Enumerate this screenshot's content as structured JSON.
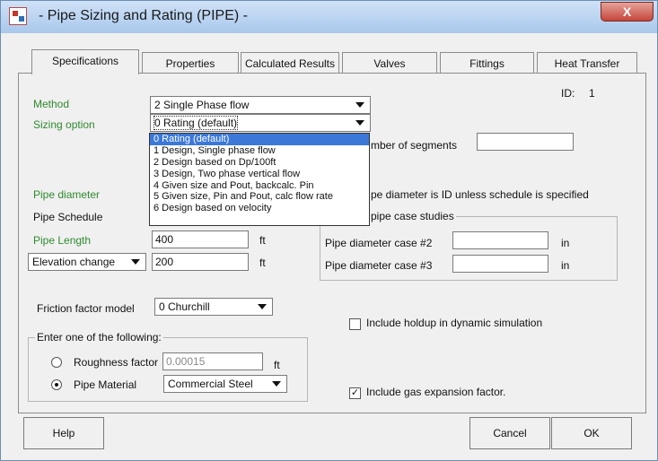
{
  "window": {
    "title": "- Pipe Sizing and Rating (PIPE) -",
    "close_label": "X"
  },
  "tabs": [
    {
      "label": "Specifications"
    },
    {
      "label": "Properties"
    },
    {
      "label": "Calculated Results"
    },
    {
      "label": "Valves"
    },
    {
      "label": "Fittings"
    },
    {
      "label": "Heat Transfer"
    }
  ],
  "id_label": "ID:",
  "id_value": "1",
  "method": {
    "label": "Method",
    "value": "2 Single Phase flow"
  },
  "sizing_option": {
    "label": "Sizing option",
    "value": "0 Rating (default)"
  },
  "sizing_dropdown": {
    "items": [
      "0 Rating (default)",
      "1 Design, Single phase flow",
      "2 Design based on Dp/100ft",
      "3 Design,  Two phase vertical flow",
      "4 Given size and Pout, backcalc. Pin",
      "5 Given size, Pin and Pout, calc flow rate",
      "6 Design based on velocity"
    ],
    "selected_index": 0
  },
  "segments": {
    "label": "mber of segments",
    "value": ""
  },
  "pipe_diameter": {
    "label": "Pipe diameter",
    "note": "pe diameter is ID unless schedule is specified"
  },
  "pipe_schedule": {
    "label": "Pipe Schedule"
  },
  "case_studies": {
    "title": "pipe case studies",
    "case2_label": "Pipe diameter case #2",
    "case2_value": "",
    "case2_unit": "in",
    "case3_label": "Pipe diameter case #3",
    "case3_value": "",
    "case3_unit": "in"
  },
  "pipe_length": {
    "label": "Pipe Length",
    "value": "400",
    "unit": "ft"
  },
  "elevation": {
    "label": "Elevation change",
    "value": "200",
    "unit": "ft"
  },
  "friction": {
    "label": "Friction factor model",
    "value": "0 Churchill"
  },
  "holdup": {
    "label": "Include holdup in dynamic simulation",
    "checked": false
  },
  "enter_one": {
    "title": "Enter one of the following:",
    "roughness_label": "Roughness factor",
    "roughness_value": "0.00015",
    "roughness_unit": "ft",
    "material_label": "Pipe Material",
    "material_value": "Commercial Steel",
    "selected": "material"
  },
  "gas_expansion": {
    "label": "Include gas expansion factor.",
    "checked": true,
    "mark": "✓"
  },
  "buttons": {
    "help": "Help",
    "cancel": "Cancel",
    "ok": "OK"
  }
}
